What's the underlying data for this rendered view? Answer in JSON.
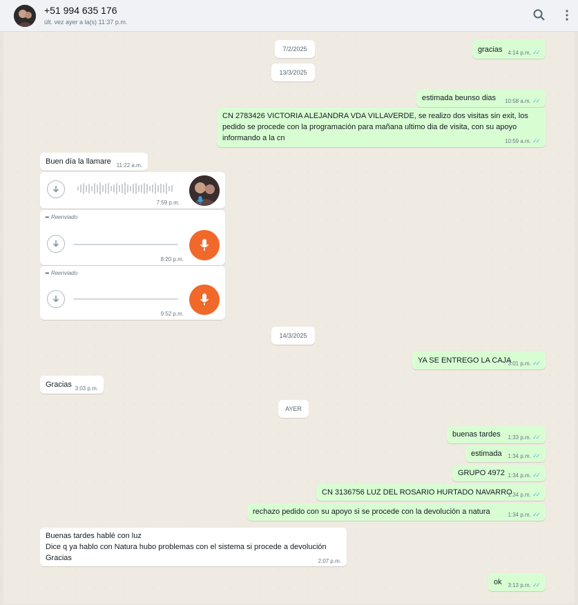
{
  "header": {
    "contact_name": "+51 994 635 176",
    "status": "últ. vez ayer a la(s) 11:37 p.m.",
    "search_icon": "search-icon",
    "menu_icon": "more-vertical-icon"
  },
  "dates": {
    "d1": "7/2/2025",
    "d2": "13/3/2025",
    "d3": "14/3/2025",
    "d4": "AYER"
  },
  "messages": {
    "m1": {
      "text": "gracias",
      "time": "4:14 p.m."
    },
    "m2": {
      "text": "estimada beunso dias",
      "time": "10:58 a.m."
    },
    "m3": {
      "text": "CN 2783426 VICTORIA ALEJANDRA VDA VILLAVERDE, se realizo dos visitas sin exit, los\npedido se procede con la programación para mañana ultimo dia de visita, con su apoyo\ninformando a la cn",
      "time": "10:59 a.m."
    },
    "m4": {
      "text": "Buen día la llamare",
      "time": "11:22 a.m."
    },
    "a1": {
      "time": "7:59 p.m."
    },
    "a2": {
      "forwarded": "Reenviado",
      "time": "8:20 p.m."
    },
    "a3": {
      "forwarded": "Reenviado",
      "time": "9:52 p.m."
    },
    "m5": {
      "text": "YA SE ENTREGO LA CAJA",
      "time": "3:01 p.m."
    },
    "m6": {
      "text": "Gracias",
      "time": "3:03 p.m."
    },
    "m7": {
      "text": "buenas tardes",
      "time": "1:33 p.m."
    },
    "m8": {
      "text": "estimada",
      "time": "1:34 p.m."
    },
    "m9": {
      "text": "GRUPO 4972",
      "time": "1:34 p.m."
    },
    "m10": {
      "text": "CN 3136756 LUZ DEL ROSARIO HURTADO NAVARRO",
      "time": "1:34 p.m."
    },
    "m11": {
      "text": "rechazo pedido con su apoyo si se procede con la devolución a natura",
      "time": "1:34 p.m."
    },
    "m12": {
      "text": "Buenas tardes hablé con luz\nDice q ya hablo con Natura hubo problemas con el sistema  si procede a devolución\nGracias",
      "time": "2:07 p.m."
    },
    "m13": {
      "text": "ok",
      "time": "3:13 p.m."
    }
  },
  "colors": {
    "outgoing_bubble": "#d9fdd3",
    "incoming_bubble": "#ffffff",
    "read_tick": "#53bdeb",
    "voice_mic": "#f0692a"
  }
}
